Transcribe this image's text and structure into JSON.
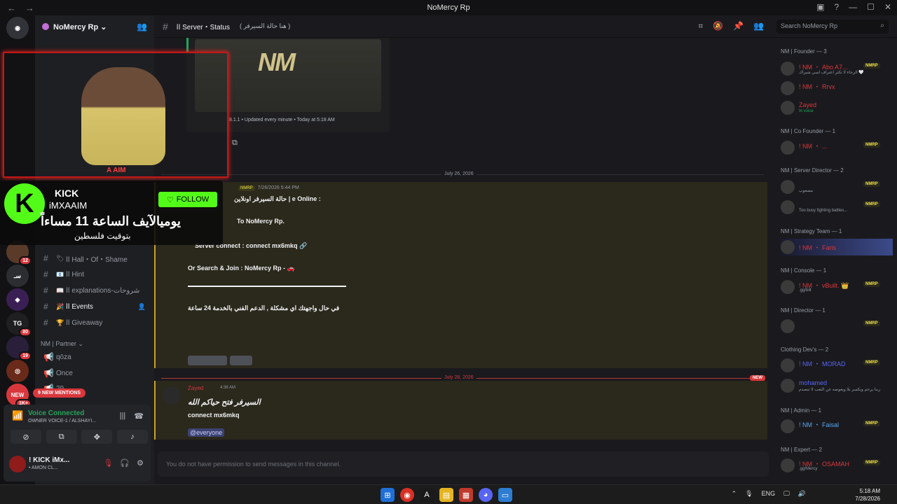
{
  "window": {
    "title": "NoMercy Rp"
  },
  "rail": {
    "badges": [
      "12",
      "80",
      "19",
      "1K+"
    ],
    "new_label": "NEW"
  },
  "server": {
    "name": "NoMercy Rp ⌄"
  },
  "channels": [
    {
      "emoji": "🏷",
      "name": "اا Hall・Of・Shame"
    },
    {
      "emoji": "📧",
      "name": "اا Hint"
    },
    {
      "emoji": "📖",
      "name": "اا explanations-شروحات"
    },
    {
      "emoji": "🎉",
      "name": "اا Events"
    },
    {
      "emoji": "🏆",
      "name": "اا Giveaway"
    }
  ],
  "partner": {
    "category": "NM | Partner ⌄",
    "items": [
      "qōza",
      "Once",
      "29"
    ]
  },
  "mentions_label": "9 NEW MENTIONS",
  "voice": {
    "status": "Voice Connected",
    "channel": "OWNER VOICE-1 / ALSHAYI..."
  },
  "user": {
    "name": "! KICK iMx...",
    "status": "• AMON CL..."
  },
  "header": {
    "channel": "اا Server・Status",
    "topic": "( هنا حالة السيرفر )",
    "search_placeholder": "Search NoMercy Rp"
  },
  "embed": {
    "logo": "NM",
    "footer": "8.1.1 • Updated every minute • Today at 5:18 AM"
  },
  "dividers": {
    "d1": "July 26, 2026",
    "d2": "July 28, 2026",
    "new": "NEW"
  },
  "msg1": {
    "tag": "NMRP",
    "time": "7/26/2026 5:44 PM",
    "lines": [
      "حالة السيرفر اونلاين | e Online :",
      "To NoMercy Rp.",
      "Server connect : connect mx6mkq 🔗",
      "Or Search & Join : NoMercy Rp - 🚗",
      "في حال واجهتك اي مشكلة , الدعم الفني بالخدمة 24 ساعة"
    ]
  },
  "msg2": {
    "author": "Zayed",
    "time": "4:36 AM",
    "text1": "السيرفر فتح حياكم الله",
    "text2": "connect mx6mkq",
    "mention": "@everyone"
  },
  "composer": "You do not have permission to send messages in this channel.",
  "members": {
    "roles": [
      "NM | Founder — 3",
      "NM | Co Founder — 1",
      "NM | Server Director — 2",
      "NM | Strategy Team — 1",
      "NM | Console — 1",
      "NM | Director — 1",
      "Clothing Dev's — 2",
      "NM | Admin — 1",
      "NM | Expert — 2"
    ],
    "list": [
      {
        "name": "! NM ・ Abo A7...",
        "status": "الرجاء لا تكثر اعتراف اسي شيراك 🤍",
        "tag": "NMRP"
      },
      {
        "name": "! NM ・ Rrvx",
        "status": "",
        "tag": ""
      },
      {
        "name": "Zayed",
        "status": "In voice",
        "tag": ""
      },
      {
        "name": "! NM ・ ...",
        "status": "",
        "tag": "NMRP"
      },
      {
        "name": "",
        "status": "مصعوب",
        "tag": "NMRP"
      },
      {
        "name": "",
        "status": "Too busy fighting battles...",
        "tag": "NMRP"
      },
      {
        "name": "! NM ・ Faris",
        "status": "",
        "tag": ""
      },
      {
        "name": "! NM ・ vBuilt. 👑",
        "status": ".gg/bilt",
        "tag": "NMRP"
      },
      {
        "name": "",
        "status": "",
        "tag": "NMRP"
      },
      {
        "name": "! NM ・ MORAD",
        "status": "",
        "tag": "NMRP"
      },
      {
        "name": "mohamed",
        "status": "ربنا يرحم ويكسر بلا ويعوضه عن التعب لا تنصدم",
        "tag": ""
      },
      {
        "name": "! NM ・ Faisal",
        "status": "",
        "tag": "NMRP"
      },
      {
        "name": "! NM ・ OSAMAH",
        "status": ".gg/Mercy",
        "tag": "NMRP"
      }
    ]
  },
  "kick": {
    "brand": "KICK",
    "user": "iMXAAIM",
    "follow": "FOLLOW",
    "ar1": "يوميالآيف الساعة 11 مساءاً",
    "ar2": "بتوقيت فلسطين"
  },
  "webcam": {
    "label": "A AIM"
  },
  "taskbar": {
    "lang": "ENG",
    "time": "5:18 AM",
    "date": "7/28/2026"
  }
}
